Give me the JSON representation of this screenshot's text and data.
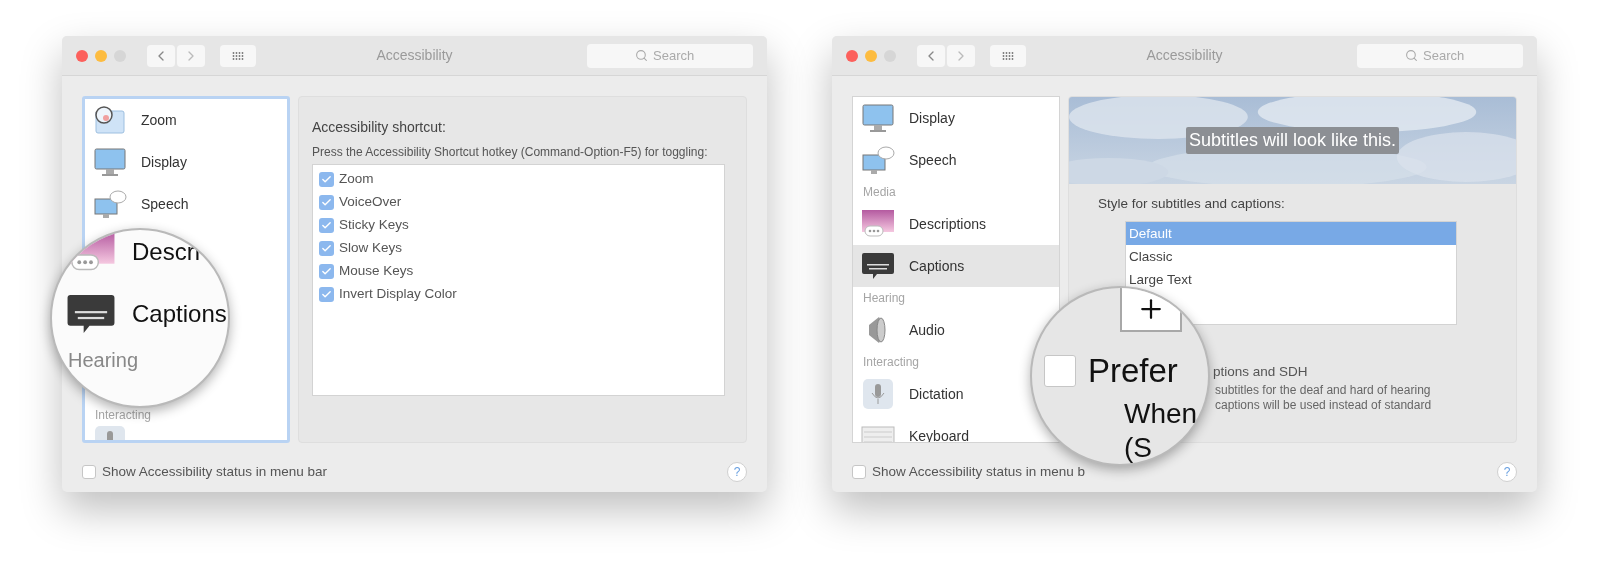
{
  "windows": [
    {
      "title": "Accessibility",
      "search": {
        "placeholder": "Search"
      },
      "sidebar": {
        "focused": true,
        "items": [
          {
            "kind": "item",
            "label": "Zoom",
            "selected": false
          },
          {
            "kind": "item",
            "label": "Display",
            "selected": false
          },
          {
            "kind": "item",
            "label": "Speech",
            "selected": false
          },
          {
            "kind": "header",
            "label": "Interacting"
          }
        ]
      },
      "shortcut_panel": {
        "heading": "Accessibility shortcut:",
        "description": "Press the Accessibility Shortcut hotkey (Command-Option-F5) for toggling:",
        "options": [
          {
            "label": "Zoom",
            "checked": true
          },
          {
            "label": "VoiceOver",
            "checked": true
          },
          {
            "label": "Sticky Keys",
            "checked": true
          },
          {
            "label": "Slow Keys",
            "checked": true
          },
          {
            "label": "Mouse Keys",
            "checked": true
          },
          {
            "label": "Invert Display Color",
            "checked": true
          }
        ]
      },
      "magnifier": {
        "items": [
          {
            "kind": "item",
            "label": "Descri"
          },
          {
            "kind": "item",
            "label": "Captions"
          },
          {
            "kind": "header",
            "label": "Hearing"
          }
        ]
      },
      "status_option": {
        "label": "Show Accessibility status in menu bar",
        "checked": false
      },
      "help": "?"
    },
    {
      "title": "Accessibility",
      "search": {
        "placeholder": "Search"
      },
      "sidebar": {
        "focused": false,
        "items": [
          {
            "kind": "item",
            "label": "Display",
            "selected": false
          },
          {
            "kind": "item",
            "label": "Speech",
            "selected": false
          },
          {
            "kind": "header",
            "label": "Media"
          },
          {
            "kind": "item",
            "label": "Descriptions",
            "selected": false
          },
          {
            "kind": "item",
            "label": "Captions",
            "selected": true
          },
          {
            "kind": "header",
            "label": "Hearing"
          },
          {
            "kind": "item",
            "label": "Audio",
            "selected": false
          },
          {
            "kind": "header",
            "label": "Interacting"
          },
          {
            "kind": "item",
            "label": "Dictation",
            "selected": false
          },
          {
            "kind": "item",
            "label": "Keyboard",
            "selected": false
          }
        ]
      },
      "captions_panel": {
        "preview_text": "Subtitles will look like this.",
        "style_label": "Style for subtitles and captions:",
        "styles": [
          {
            "label": "Default",
            "selected": true
          },
          {
            "label": "Classic",
            "selected": false
          },
          {
            "label": "Large Text",
            "selected": false
          }
        ],
        "sdh_label": "ptions and SDH",
        "sdh_description": [
          "subtitles for the deaf and hard of hearing",
          "captions will be used instead of standard"
        ]
      },
      "magnifier": {
        "checked": false,
        "texts": [
          "Prefer",
          "When",
          "(S"
        ]
      },
      "status_option": {
        "label": "Show Accessibility status in menu b",
        "checked": false
      },
      "help": "?"
    }
  ]
}
